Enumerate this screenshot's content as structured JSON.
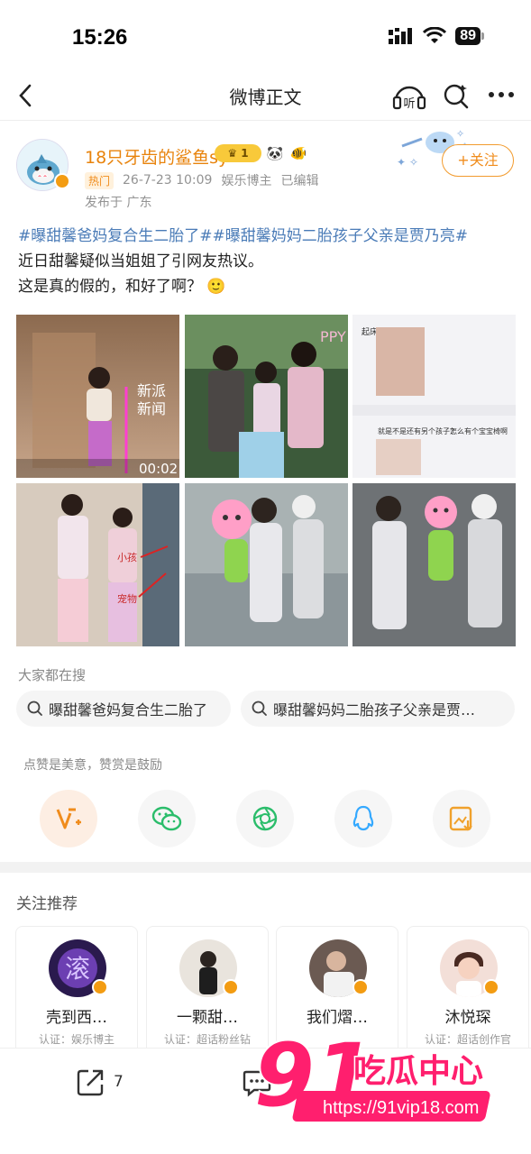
{
  "status_bar": {
    "time": "15:26",
    "battery": "89"
  },
  "nav": {
    "title": "微博正文",
    "listen_label": "听"
  },
  "post": {
    "author": "18只牙齿的鲨鱼sy",
    "level_badge": "1",
    "hot_tag": "热门",
    "time": "26-7-23 10:09",
    "role": "娱乐博主",
    "edited": "已编辑",
    "location": "发布于 广东",
    "follow_label": "+关注",
    "hashtags": "#曝甜馨爸妈复合生二胎了##曝甜馨妈妈二胎孩子父亲是贾乃亮#",
    "line1": "近日甜馨疑似当姐姐了引网友热议。",
    "line2": "这是真的假的，和好了啊？",
    "emoji": "🙂",
    "image1_text": "新派\n新闻",
    "image1_time": "00:02",
    "image3_caption1": "就是不是还有另个孩子？",
    "image3_caption2": "怎么有个宝宝椅啊",
    "image3_top": "起床的地方。",
    "image4_label1": "小孩",
    "image4_label2": "宠物",
    "image2_banner": "PPY"
  },
  "search": {
    "title": "大家都在搜",
    "chips": [
      "曝甜馨爸妈复合生二胎了",
      "曝甜馨妈妈二胎孩子父亲是贾…"
    ]
  },
  "reward": {
    "title": "点赞是美意，赞赏是鼓励"
  },
  "recommend": {
    "title": "关注推荐",
    "cards": [
      {
        "name": "壳到西…",
        "cert": "认证：娱乐博主"
      },
      {
        "name": "一颗甜…",
        "cert": "认证：超话粉丝钻"
      },
      {
        "name": "我们熠…",
        "cert": ""
      },
      {
        "name": "沐悦琛",
        "cert": "认证：超话创作官"
      }
    ]
  },
  "bottom": {
    "repost_count": "7"
  },
  "watermark": {
    "brand_num": "91",
    "brand_text": "吃瓜中心",
    "url": "https://91vip18.com"
  },
  "colors": {
    "accent": "#f08c1c",
    "link": "#4a7bb7",
    "brand_pink": "#ff1f6e"
  }
}
